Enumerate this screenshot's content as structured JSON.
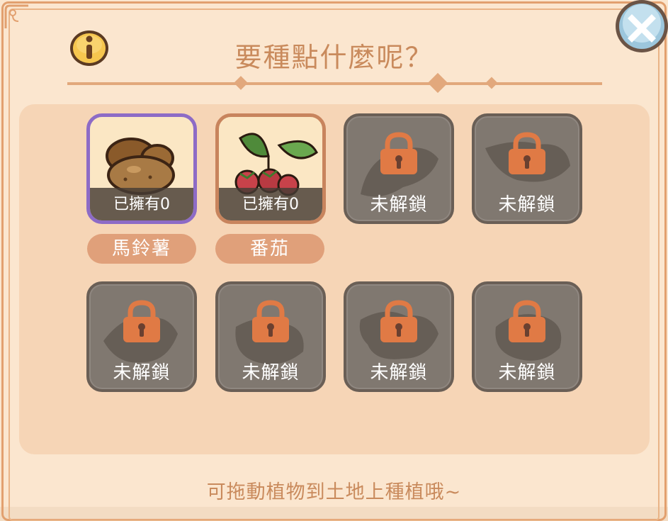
{
  "dialog": {
    "title": "要種點什麼呢？",
    "hint": "可拖動植物到土地上種植哦~",
    "info_icon": "info-icon",
    "close_icon": "close-icon"
  },
  "crops": [
    {
      "name": "馬鈴薯",
      "owned_label": "已擁有0",
      "icon": "potato-icon",
      "selected": true
    },
    {
      "name": "番茄",
      "owned_label": "已擁有0",
      "icon": "tomato-icon",
      "selected": false
    }
  ],
  "locked_label": "未解鎖",
  "locked_slots": [
    {
      "label": "未解鎖",
      "icon": "lock-icon"
    },
    {
      "label": "未解鎖",
      "icon": "lock-icon"
    },
    {
      "label": "未解鎖",
      "icon": "lock-icon"
    },
    {
      "label": "未解鎖",
      "icon": "lock-icon"
    },
    {
      "label": "未解鎖",
      "icon": "lock-icon"
    },
    {
      "label": "未解鎖",
      "icon": "lock-icon"
    }
  ],
  "colors": {
    "panel_bg": "#fbe6cf",
    "title_text": "#c98a5c",
    "pill_bg": "#e0a07a",
    "lock_orange": "#e07a45",
    "locked_tile": "#807870",
    "selected_border": "#8d6bc6"
  }
}
